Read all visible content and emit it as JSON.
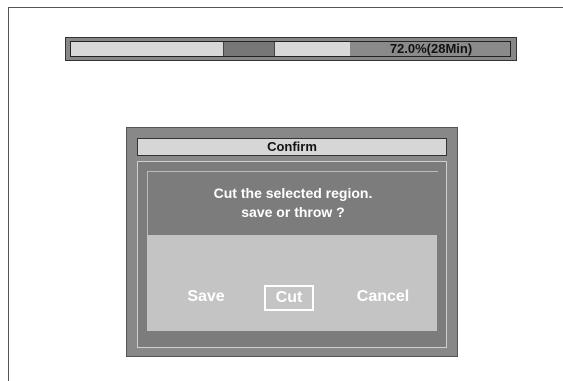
{
  "progress": {
    "label": "72.0%(28Min)",
    "percent": 72.0
  },
  "dialog": {
    "title": "Confirm",
    "message_line1": "Cut the selected region.",
    "message_line2": "save or throw ?",
    "buttons": {
      "save": "Save",
      "cut": "Cut",
      "cancel": "Cancel"
    },
    "focused_button": "cut"
  }
}
